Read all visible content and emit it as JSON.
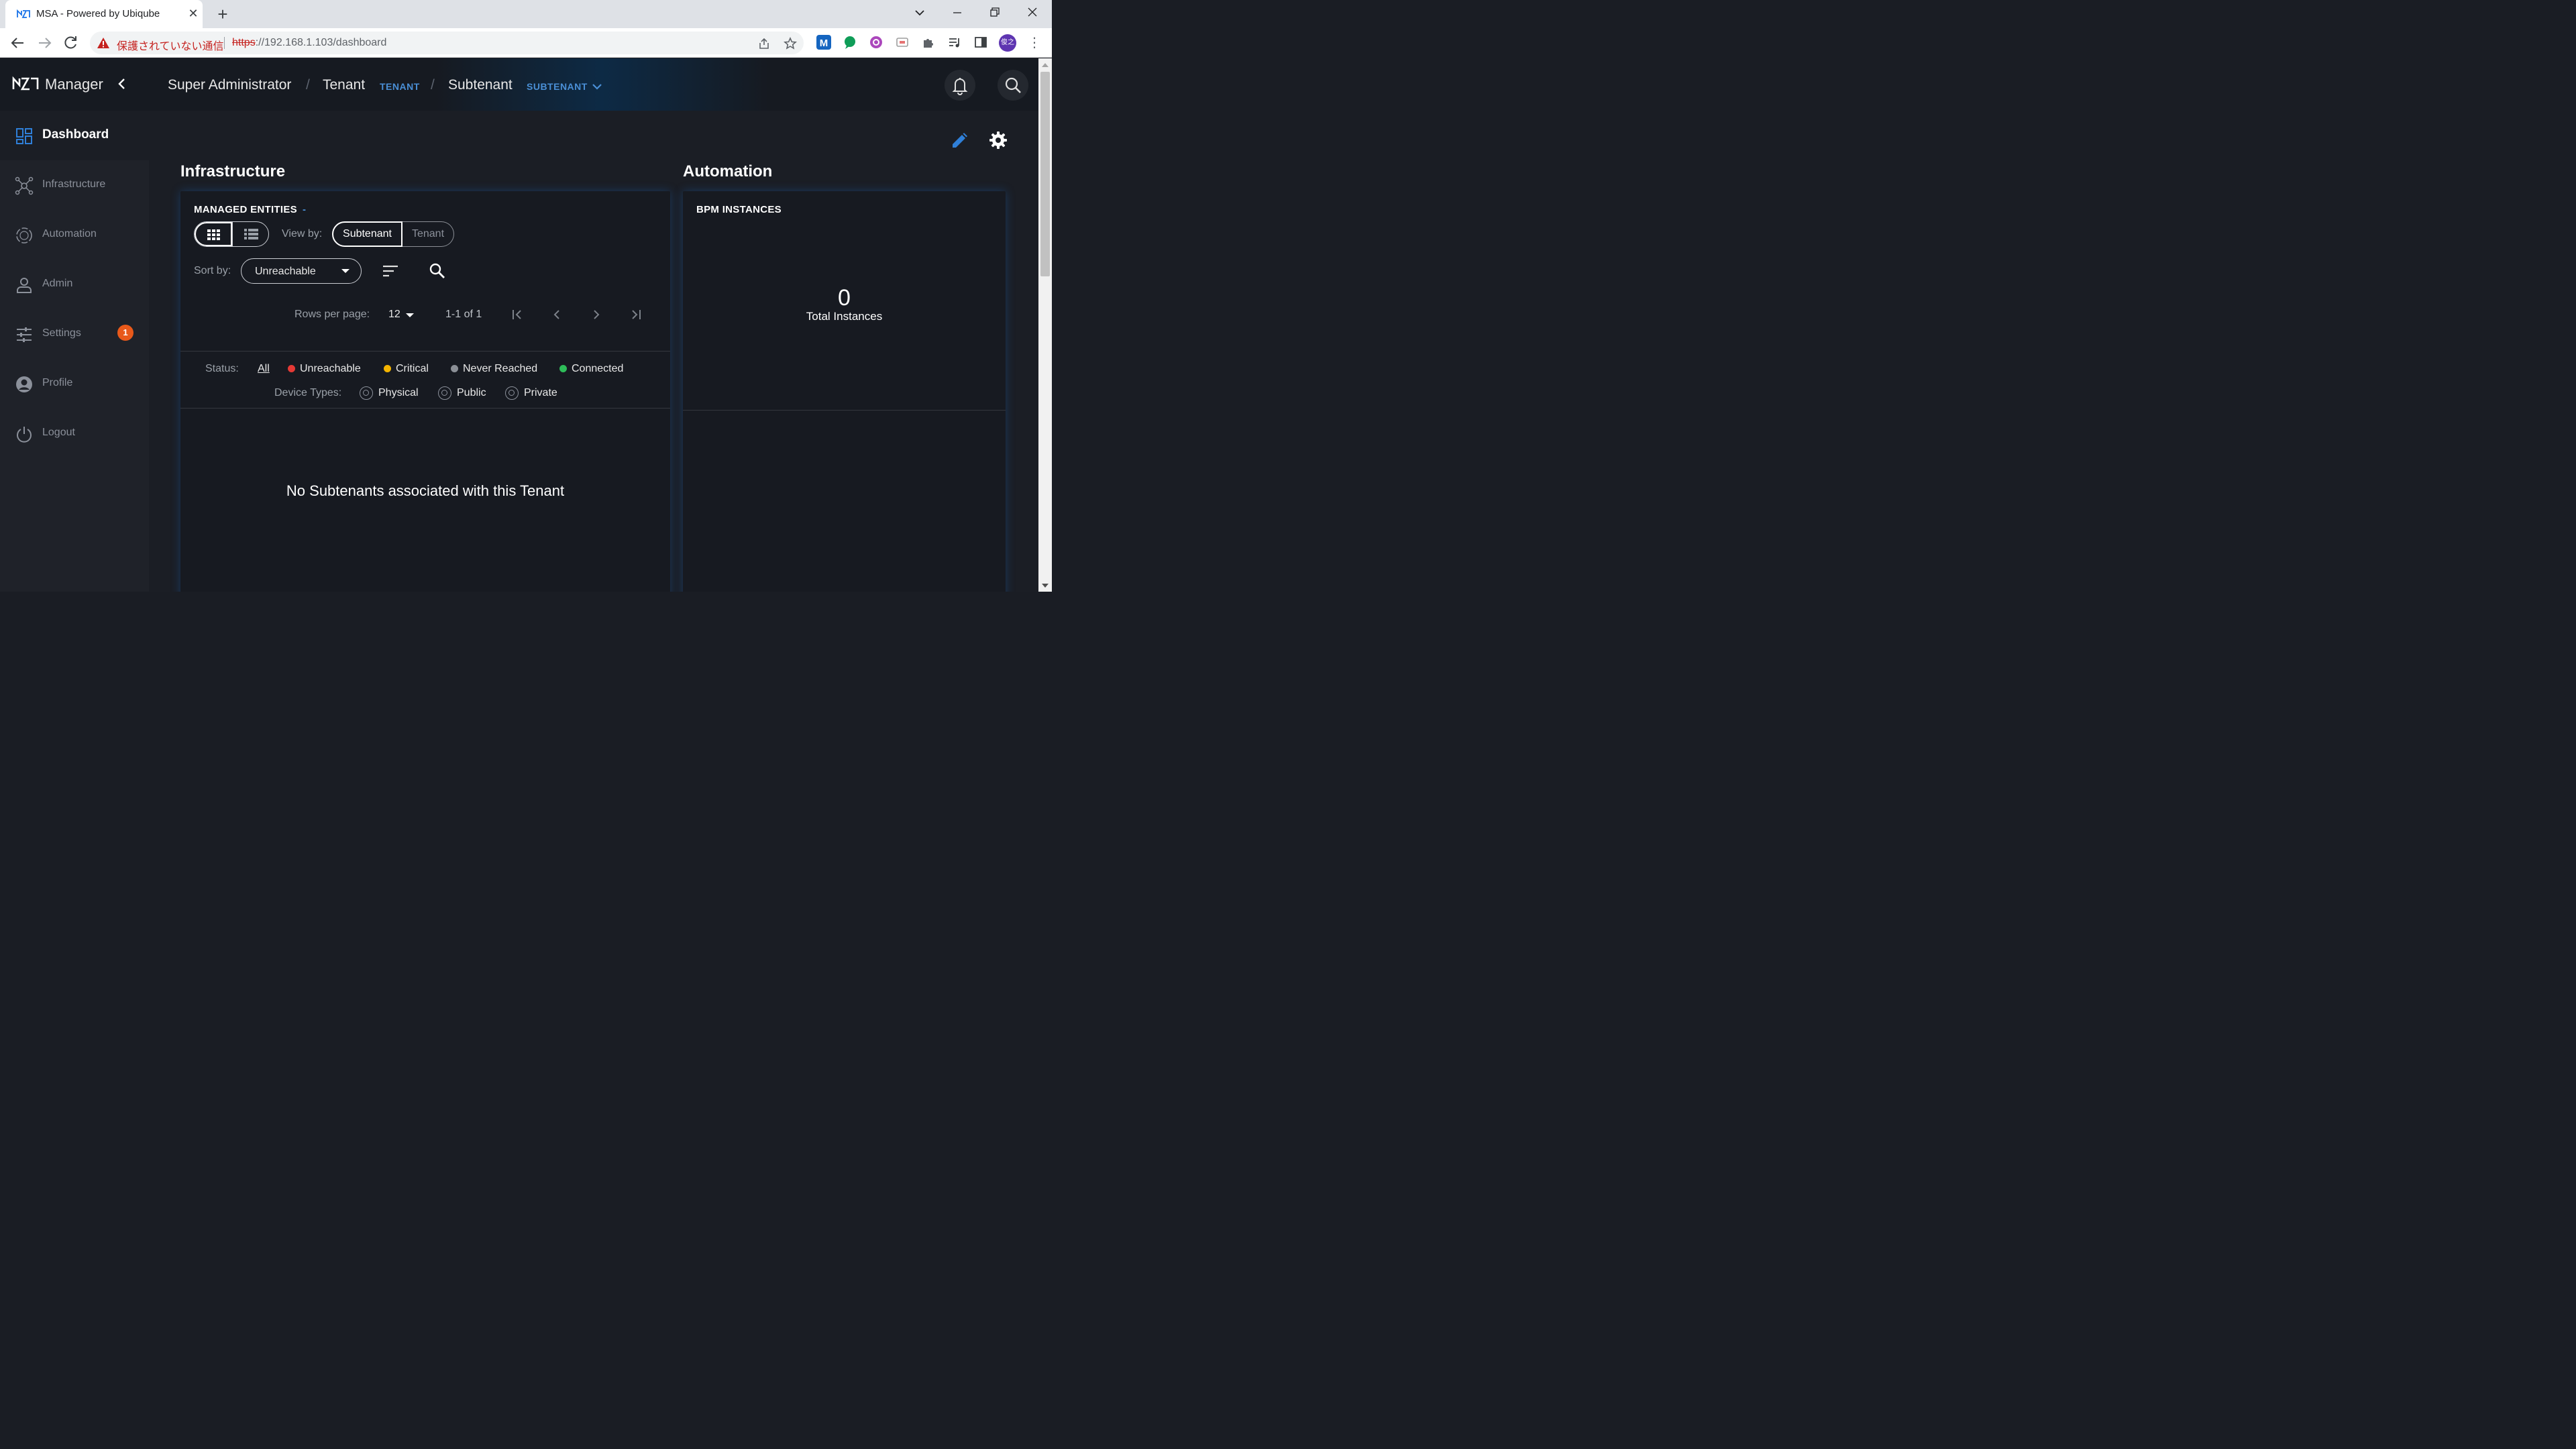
{
  "browser": {
    "tab_title": "MSA - Powered by Ubiqube",
    "not_secure_label": "保護されていない通信",
    "url_scheme": "https",
    "url_rest": "://192.168.1.103/dashboard",
    "profile_initials": "俊之"
  },
  "topbar": {
    "brand": "Manager",
    "breadcrumb": [
      {
        "label": "Super Administrator"
      },
      {
        "label": "Tenant",
        "tag": "TENANT"
      },
      {
        "label": "Subtenant",
        "tag": "SUBTENANT"
      }
    ]
  },
  "sidebar": {
    "items": [
      {
        "label": "Dashboard",
        "icon": "dashboard-icon",
        "active": true
      },
      {
        "label": "Infrastructure",
        "icon": "infrastructure-icon"
      },
      {
        "label": "Automation",
        "icon": "automation-icon"
      },
      {
        "label": "Admin",
        "icon": "admin-icon"
      },
      {
        "label": "Settings",
        "icon": "settings-sliders-icon",
        "badge": "1"
      },
      {
        "label": "Profile",
        "icon": "profile-icon"
      },
      {
        "label": "Logout",
        "icon": "logout-icon"
      }
    ]
  },
  "infrastructure": {
    "title": "Infrastructure",
    "panel_title": "MANAGED ENTITIES",
    "panel_title_suffix": "-",
    "view_by_label": "View by:",
    "view_by_options": [
      "Subtenant",
      "Tenant"
    ],
    "view_by_selected": "Subtenant",
    "sort_by_label": "Sort by:",
    "sort_by_value": "Unreachable",
    "rows_per_page_label": "Rows per page:",
    "rows_per_page_value": "12",
    "range_text": "1-1 of 1",
    "status_label": "Status:",
    "status_all": "All",
    "statuses": [
      {
        "label": "Unreachable",
        "color": "#e53935"
      },
      {
        "label": "Critical",
        "color": "#f4b400"
      },
      {
        "label": "Never Reached",
        "color": "#8b8f96"
      },
      {
        "label": "Connected",
        "color": "#2ebd59"
      }
    ],
    "device_types_label": "Device Types:",
    "device_types": [
      "Physical",
      "Public",
      "Private"
    ],
    "empty_message": "No Subtenants associated with this Tenant"
  },
  "automation": {
    "title": "Automation",
    "panel_title": "BPM INSTANCES",
    "total_value": "0",
    "total_label": "Total Instances"
  },
  "colors": {
    "accent": "#4a8fd6",
    "badge": "#e8591a",
    "background": "#1b1e25"
  }
}
